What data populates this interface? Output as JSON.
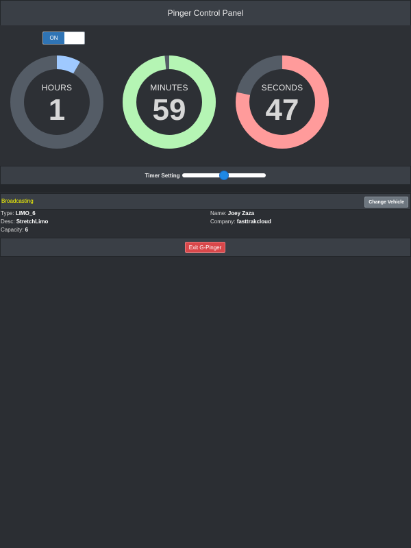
{
  "header": {
    "title": "Pinger Control Panel"
  },
  "toggle": {
    "on_label": "ON",
    "state": "on"
  },
  "gauges": [
    {
      "label": "HOURS",
      "value": "1",
      "fraction": 0.0833,
      "color": "#9fc9ff"
    },
    {
      "label": "MINUTES",
      "value": "59",
      "fraction": 0.9833,
      "color": "#b5f5b4"
    },
    {
      "label": "SECONDS",
      "value": "47",
      "fraction": 0.7833,
      "color": "#ff9b9b"
    }
  ],
  "timer": {
    "label": "Timer Setting",
    "slider_fraction": 0.5
  },
  "broadcast": {
    "title": "Broadcasting",
    "change_button": "Change Vehicle"
  },
  "vehicle": {
    "type_label": "Type:",
    "type_value": "LIMO_6",
    "desc_label": "Desc:",
    "desc_value": "StretchLimo",
    "capacity_label": "Capacity:",
    "capacity_value": "6",
    "name_label": "Name:",
    "name_value": "Joey Zaza",
    "company_label": "Company:",
    "company_value": "fasttrakcloud"
  },
  "exit": {
    "label": "Exit G-Pinger"
  },
  "colors": {
    "ring_track": "#545c66",
    "accent": "#2f74b5",
    "broadcast_text": "#ffff00",
    "exit_button": "#d9474a"
  }
}
